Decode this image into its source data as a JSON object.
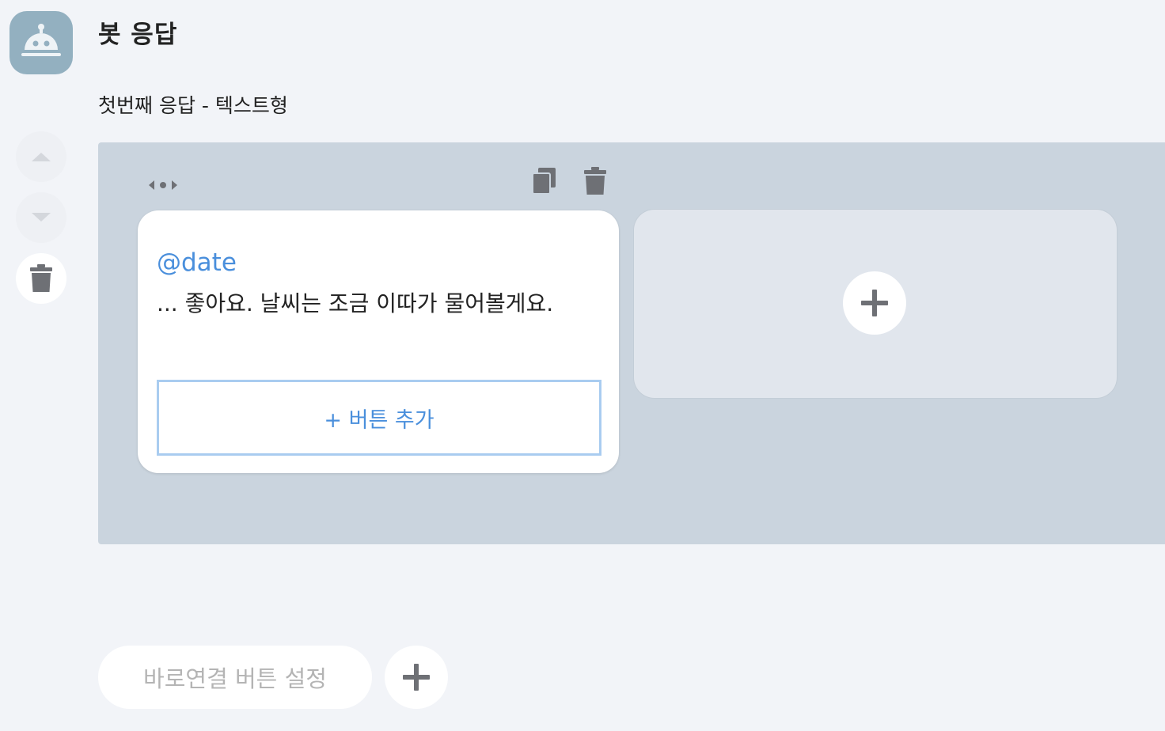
{
  "bot": {
    "title": "봇 응답",
    "avatar_icon": "robot-icon",
    "avatar_color": "#93b0c0"
  },
  "response": {
    "subtitle": "첫번째 응답 - 텍스트형"
  },
  "side_controls": {
    "move_up_icon": "caret-up-icon",
    "move_down_icon": "caret-down-icon",
    "delete_icon": "trash-icon"
  },
  "card": {
    "variable": "@date",
    "text": "... 좋아요. 날씨는 조금 이따가 물어볼게요.",
    "add_button_label": "+ 버튼 추가",
    "accent_color": "#4a8fdc",
    "toolbar_icons": [
      "drag-handle-icon",
      "copy-icon",
      "trash-icon"
    ]
  },
  "add_card": {
    "icon": "plus-icon"
  },
  "footer": {
    "quick_link_label": "바로연결 버튼 설정",
    "add_icon": "plus-icon"
  }
}
